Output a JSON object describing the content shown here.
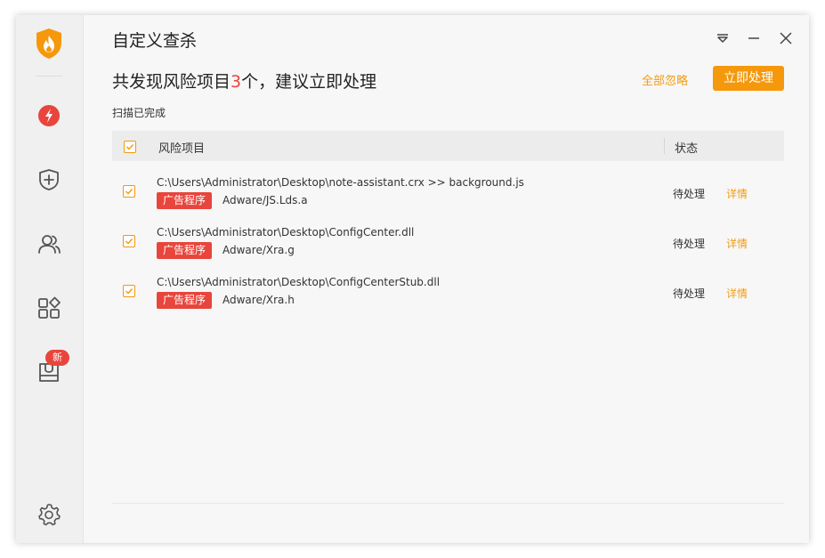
{
  "window": {
    "title": "自定义查杀"
  },
  "summary": {
    "prefix": "共发现风险项目",
    "count": "3",
    "suffix": "个，建议立即处理",
    "scan_status": "扫描已完成"
  },
  "actions": {
    "ignore_all": "全部忽略",
    "handle_now": "立即处理"
  },
  "table": {
    "columns": [
      "风险项目",
      "状态"
    ],
    "rows": [
      {
        "path": "C:\\Users\\Administrator\\Desktop\\note-assistant.crx >> background.js",
        "tag": "广告程序",
        "name": "Adware/JS.Lds.a",
        "status": "待处理",
        "detail": "详情"
      },
      {
        "path": "C:\\Users\\Administrator\\Desktop\\ConfigCenter.dll",
        "tag": "广告程序",
        "name": "Adware/Xra.g",
        "status": "待处理",
        "detail": "详情"
      },
      {
        "path": "C:\\Users\\Administrator\\Desktop\\ConfigCenterStub.dll",
        "tag": "广告程序",
        "name": "Adware/Xra.h",
        "status": "待处理",
        "detail": "详情"
      }
    ]
  },
  "sidebar": {
    "items": [
      {
        "icon": "lightning-icon"
      },
      {
        "icon": "shield-plus-icon"
      },
      {
        "icon": "users-icon"
      },
      {
        "icon": "apps-icon"
      },
      {
        "icon": "box-icon",
        "badge": "新"
      },
      {
        "icon": "gear-icon"
      }
    ]
  },
  "colors": {
    "accent": "#f5980b",
    "danger": "#e8453c",
    "sidebar_bg": "#f0f0f0",
    "content_bg": "#f7f7f7"
  }
}
